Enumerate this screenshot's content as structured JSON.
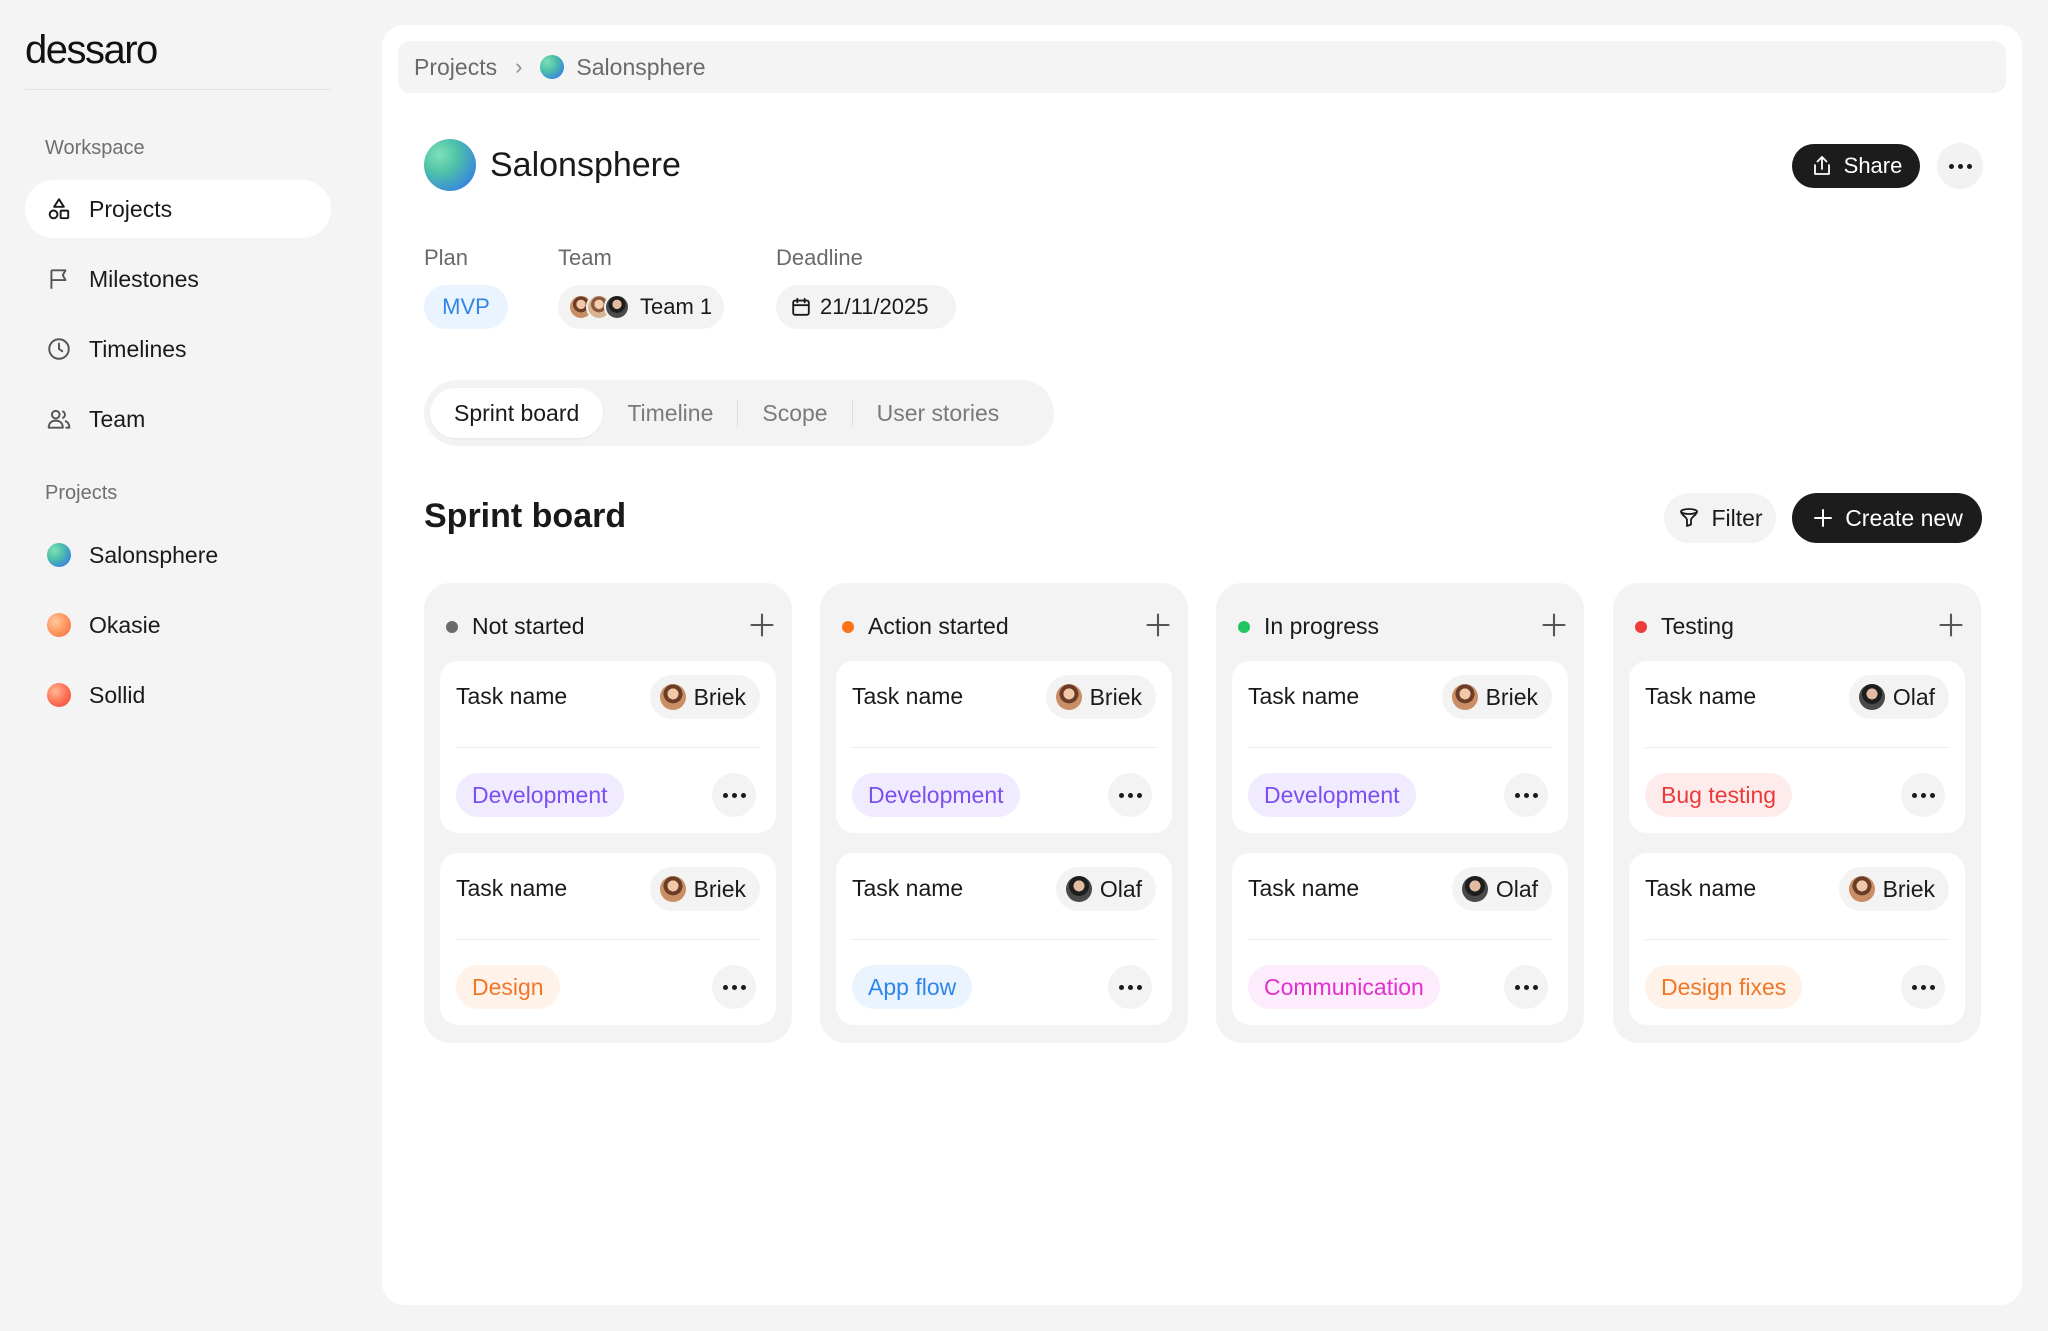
{
  "app": {
    "logo": "dessaro"
  },
  "sidebar": {
    "workspace_label": "Workspace",
    "items": [
      {
        "label": "Projects",
        "icon": "shapes-icon",
        "active": true
      },
      {
        "label": "Milestones",
        "icon": "flag-icon"
      },
      {
        "label": "Timelines",
        "icon": "clock-icon"
      },
      {
        "label": "Team",
        "icon": "users-icon"
      }
    ],
    "projects_label": "Projects",
    "projects": [
      {
        "label": "Salonsphere",
        "icon": "project-orb-icon"
      },
      {
        "label": "Okasie",
        "icon": "project-orb-icon"
      },
      {
        "label": "Sollid",
        "icon": "project-orb-icon"
      }
    ]
  },
  "breadcrumb": {
    "root": "Projects",
    "current": "Salonsphere"
  },
  "header": {
    "title": "Salonsphere",
    "share_label": "Share"
  },
  "meta": {
    "plan_label": "Plan",
    "plan_value": "MVP",
    "team_label": "Team",
    "team_value": "Team 1",
    "deadline_label": "Deadline",
    "deadline_value": "21/11/2025"
  },
  "tabs": [
    "Sprint board",
    "Timeline",
    "Scope",
    "User stories"
  ],
  "board": {
    "title": "Sprint board",
    "filter_label": "Filter",
    "create_label": "Create new",
    "columns": [
      {
        "title": "Not started",
        "dot_color": "#6b6b6b",
        "cards": [
          {
            "name": "Task name",
            "assignee": "Briek",
            "tag": "Development",
            "tag_color": "#7b4ff0",
            "tag_bg": "#f0ebff"
          },
          {
            "name": "Task name",
            "assignee": "Briek",
            "tag": "Design",
            "tag_color": "#f0772a",
            "tag_bg": "#fff2e8"
          }
        ]
      },
      {
        "title": "Action started",
        "dot_color": "#f97316",
        "cards": [
          {
            "name": "Task name",
            "assignee": "Briek",
            "tag": "Development",
            "tag_color": "#7b4ff0",
            "tag_bg": "#f0ebff"
          },
          {
            "name": "Task name",
            "assignee": "Olaf",
            "tag": "App flow",
            "tag_color": "#2f86e8",
            "tag_bg": "#eaf4ff"
          }
        ]
      },
      {
        "title": "In progress",
        "dot_color": "#22c55e",
        "cards": [
          {
            "name": "Task name",
            "assignee": "Briek",
            "tag": "Development",
            "tag_color": "#7b4ff0",
            "tag_bg": "#f0ebff"
          },
          {
            "name": "Task name",
            "assignee": "Olaf",
            "tag": "Communication",
            "tag_color": "#e22fd0",
            "tag_bg": "#fdecfb"
          }
        ]
      },
      {
        "title": "Testing",
        "dot_color": "#ef3b3b",
        "cards": [
          {
            "name": "Task name",
            "assignee": "Olaf",
            "tag": "Bug testing",
            "tag_color": "#ea3b3b",
            "tag_bg": "#feecec"
          },
          {
            "name": "Task name",
            "assignee": "Briek",
            "tag": "Design fixes",
            "tag_color": "#f0772a",
            "tag_bg": "#fff2e8"
          }
        ]
      }
    ]
  }
}
